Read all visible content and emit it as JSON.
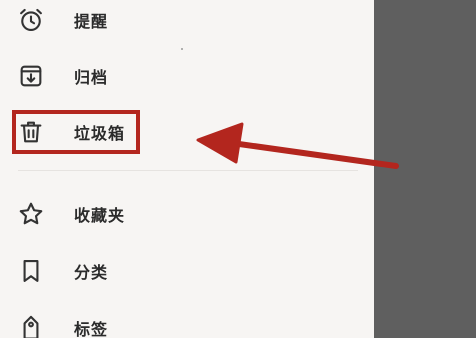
{
  "drawer": {
    "items": [
      {
        "label": "提醒",
        "icon": "alarm-clock-icon"
      },
      {
        "label": "归档",
        "icon": "archive-icon"
      },
      {
        "label": "垃圾箱",
        "icon": "trash-icon"
      },
      {
        "label": "收藏夹",
        "icon": "star-icon"
      },
      {
        "label": "分类",
        "icon": "bookmark-icon"
      },
      {
        "label": "标签",
        "icon": "tag-icon"
      }
    ]
  },
  "annotation": {
    "highlight_target": "垃圾箱",
    "highlight_color": "#b3261e",
    "arrow_color": "#b3261e"
  },
  "colors": {
    "drawer_background": "#f7f5f3",
    "scrim": "#5f5f5f",
    "text": "#2b2b2b",
    "icon": "#333333"
  }
}
